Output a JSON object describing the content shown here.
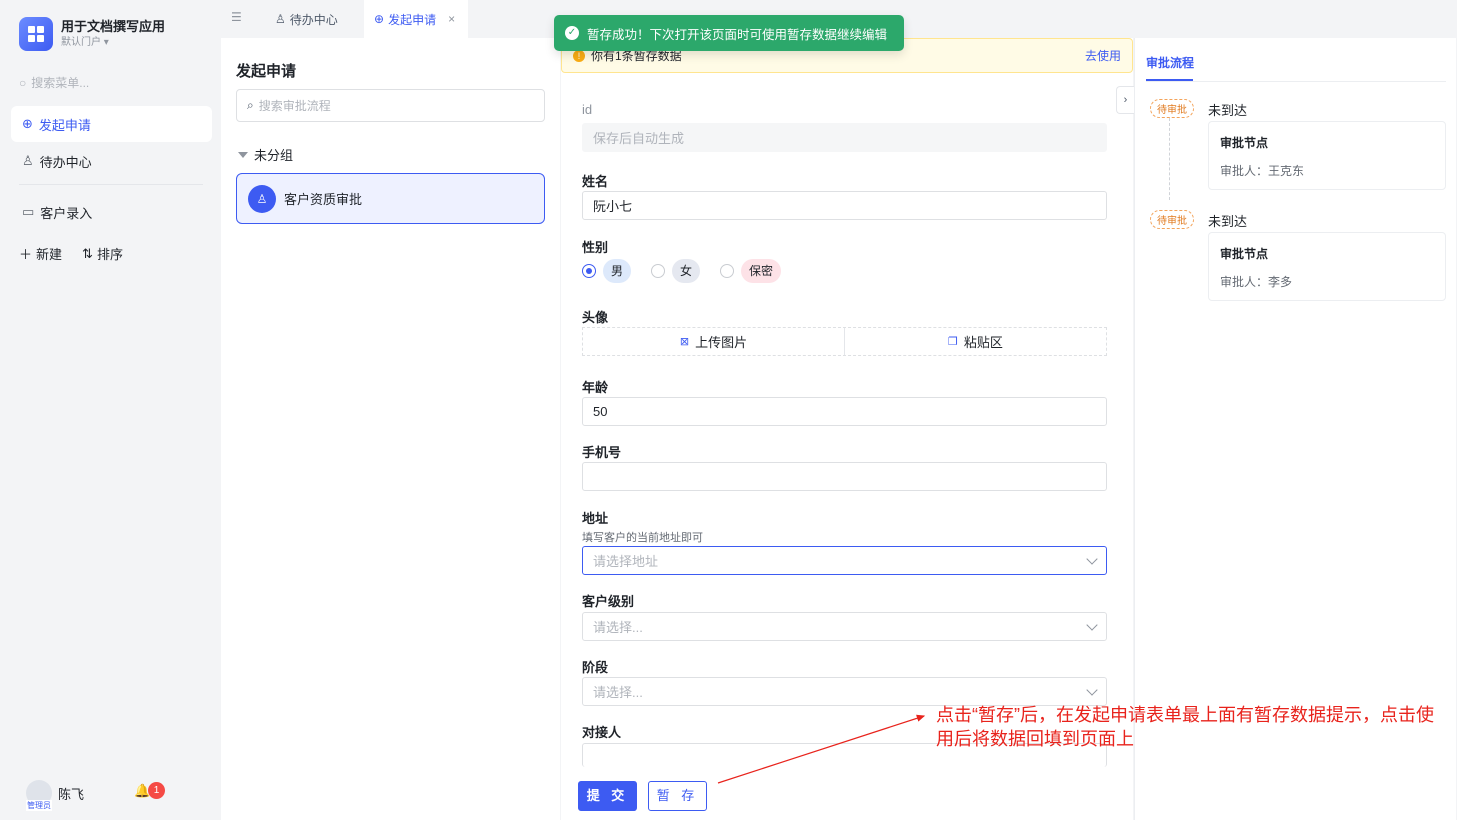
{
  "app": {
    "title": "用于文档撰写应用",
    "portal": "默认门户"
  },
  "sidebar": {
    "search_placeholder": "搜索菜单...",
    "items": [
      {
        "label": "发起申请",
        "icon": "plus-circle-icon",
        "active": true
      },
      {
        "label": "待办中心",
        "icon": "stamp-icon"
      },
      {
        "label": "客户录入",
        "icon": "form-icon"
      }
    ],
    "new_label": "新建",
    "sort_label": "排序",
    "user_name": "陈飞",
    "user_role": "管理员",
    "notification_count": "1"
  },
  "tabs": [
    {
      "label": "待办中心"
    },
    {
      "label": "发起申请",
      "active": true
    }
  ],
  "toast": {
    "message": "暂存成功！下次打开该页面时可使用暂存数据继续编辑"
  },
  "left_panel": {
    "title": "发起申请",
    "search_placeholder": "搜索审批流程",
    "group": "未分组",
    "flow": "客户资质审批"
  },
  "draft_bar": {
    "message": "你有1条暂存数据",
    "action": "去使用"
  },
  "form": {
    "id": {
      "label": "id",
      "placeholder": "保存后自动生成"
    },
    "name": {
      "label": "姓名",
      "value": "阮小七"
    },
    "gender": {
      "label": "性别",
      "options": [
        "男",
        "女",
        "保密"
      ],
      "selected": "男"
    },
    "avatar": {
      "label": "头像",
      "upload": "上传图片",
      "paste": "粘贴区"
    },
    "age": {
      "label": "年龄",
      "value": "50"
    },
    "phone": {
      "label": "手机号",
      "value": ""
    },
    "address": {
      "label": "地址",
      "hint": "填写客户的当前地址即可",
      "placeholder": "请选择地址"
    },
    "level": {
      "label": "客户级别",
      "placeholder": "请选择..."
    },
    "stage": {
      "label": "阶段",
      "placeholder": "请选择..."
    },
    "contact": {
      "label": "对接人"
    },
    "submit_label": "提 交",
    "save_draft_label": "暂 存"
  },
  "approval": {
    "tab": "审批流程",
    "steps": [
      {
        "tag": "待审批",
        "state": "未到达",
        "node": "审批节点",
        "approver": "审批人：王克东"
      },
      {
        "tag": "待审批",
        "state": "未到达",
        "node": "审批节点",
        "approver": "审批人：李多"
      }
    ]
  },
  "annotation": {
    "text": "点击“暂存”后，在发起申请表单最上面有暂存数据提示，点击使用后将数据回填到页面上"
  },
  "colors": {
    "accent": "#3d5bf2",
    "success": "#2ca86b",
    "annotation": "#e8231c",
    "warning": "#faad14"
  }
}
